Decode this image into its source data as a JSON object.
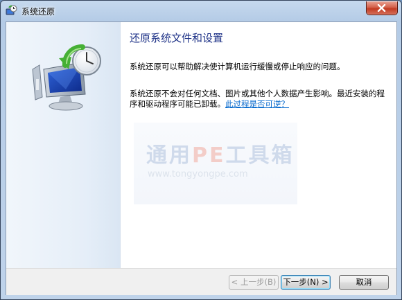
{
  "window": {
    "title": "系统还原",
    "close_icon": "close-icon"
  },
  "main": {
    "heading": "还原系统文件和设置",
    "description": "系统还原可以帮助解决使计算机运行缓慢或停止响应的问题。",
    "warning_text": "系统还原不会对任何文档、图片或其他个人数据产生影响。最近安装的程序和驱动程序可能已卸载。",
    "undo_link": "此过程是否可逆？"
  },
  "watermark": {
    "title_a": "通用",
    "title_pe": "PE",
    "title_b": "工具箱",
    "url": "www.tongyongpe.com"
  },
  "buttons": {
    "back": "< 上一步(B)",
    "next": "下一步(N) >",
    "cancel": "取消"
  },
  "icons": {
    "app": "system-restore-icon",
    "hero": "monitor-clock-restore-icon"
  },
  "colors": {
    "heading": "#1e3287",
    "link": "#0066cc",
    "titlebar": "#b4cbe6",
    "close_button": "#c23a22"
  }
}
